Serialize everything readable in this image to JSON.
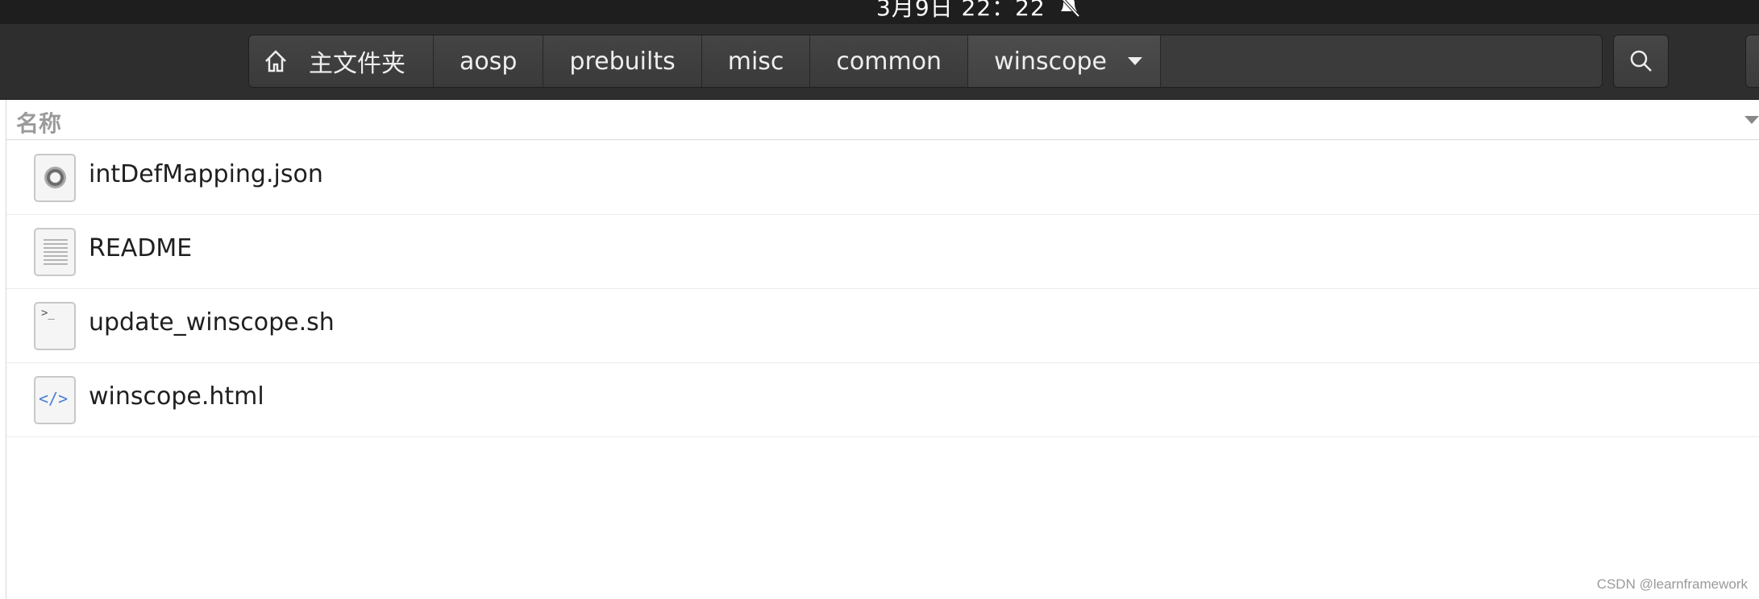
{
  "system_bar": {
    "clock": "3月9日  22：22",
    "notification_icon": "bell-muted-icon"
  },
  "pathbar": {
    "home_icon": "home-icon",
    "crumbs": [
      "主文件夹",
      "aosp",
      "prebuilts",
      "misc",
      "common",
      "winscope"
    ],
    "current_menu_icon": "chevron-down-icon"
  },
  "toolbar": {
    "search_icon": "search-icon"
  },
  "list": {
    "column_header": "名称",
    "files": [
      {
        "name": "intDefMapping.json",
        "icon": "json-file-icon"
      },
      {
        "name": "README",
        "icon": "text-file-icon"
      },
      {
        "name": "update_winscope.sh",
        "icon": "script-file-icon"
      },
      {
        "name": "winscope.html",
        "icon": "html-file-icon"
      }
    ]
  },
  "watermark": "CSDN @learnframework",
  "colors": {
    "headerbar": "#2e2e2e",
    "topbar": "#1e1e1e",
    "accent_code": "#4a7fd4"
  }
}
